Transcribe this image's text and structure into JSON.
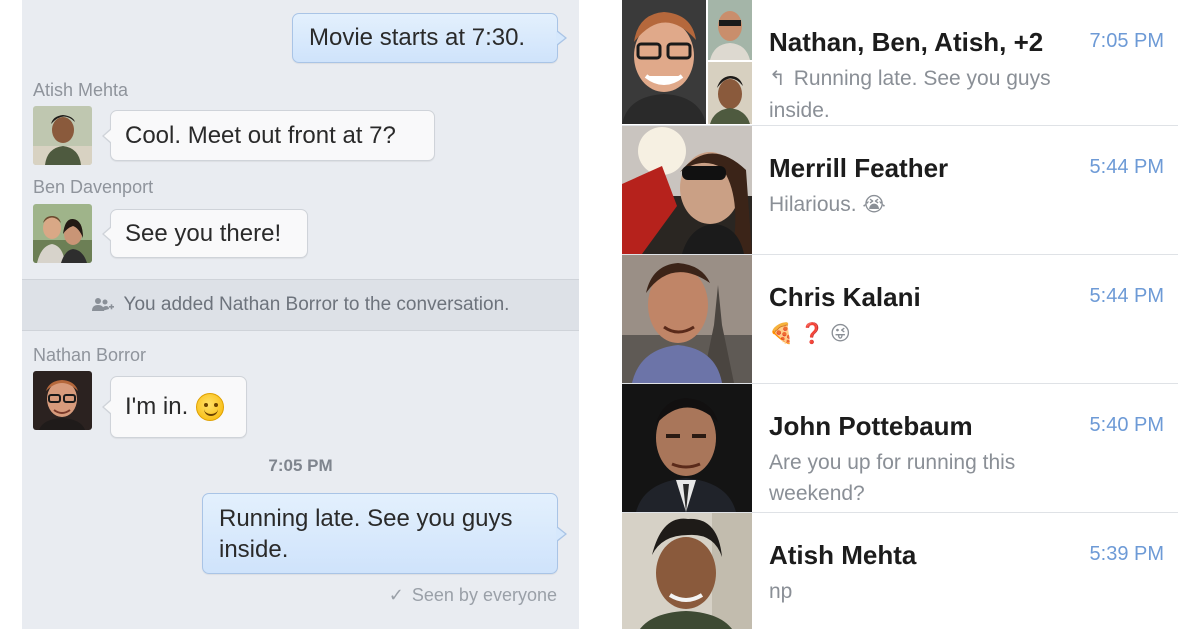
{
  "chat": {
    "messages": [
      {
        "type": "outgoing",
        "text": "Movie starts at 7:30."
      },
      {
        "type": "incoming",
        "sender": "Atish Mehta",
        "text": "Cool. Meet out front at 7?"
      },
      {
        "type": "incoming",
        "sender": "Ben Davenport",
        "text": "See you there!"
      },
      {
        "type": "system",
        "text": "You added Nathan Borror to the conversation."
      },
      {
        "type": "incoming",
        "sender": "Nathan Borror",
        "text": "I'm in."
      },
      {
        "type": "time",
        "text": "7:05 PM"
      },
      {
        "type": "outgoing",
        "text": "Running late. See you guys inside."
      }
    ],
    "seen_label": "Seen by everyone",
    "colors": {
      "background": "#e9ecf1",
      "outgoing_bubble": "#d6e8fc",
      "incoming_bubble": "#f9f9fa"
    }
  },
  "conversations": [
    {
      "name": "Nathan, Ben, Atish, +2",
      "time": "7:05 PM",
      "preview": "Running late. See you guys inside.",
      "is_reply": true
    },
    {
      "name": "Merrill Feather",
      "time": "5:44 PM",
      "preview": "Hilarious.",
      "emoji": "😭"
    },
    {
      "name": "Chris Kalani",
      "time": "5:44 PM",
      "preview": "",
      "emoji": "🍕 ❓ 😜"
    },
    {
      "name": "John Pottebaum",
      "time": "5:40 PM",
      "preview": "Are you up for running this weekend?"
    },
    {
      "name": "Atish Mehta",
      "time": "5:39 PM",
      "preview": "np"
    }
  ],
  "accent_color": "#6d9ad6"
}
